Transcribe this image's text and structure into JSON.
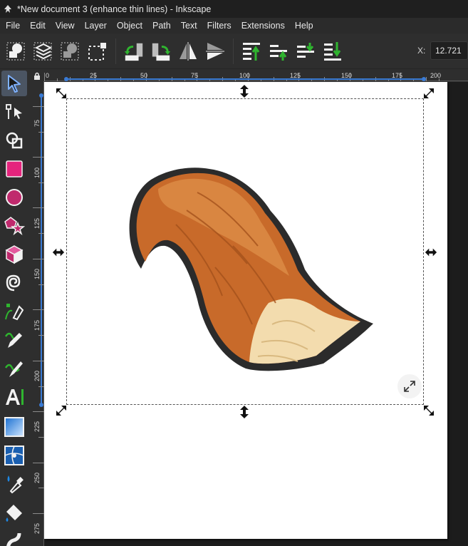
{
  "window": {
    "title": "*New document 3 (enhance thin lines) - Inkscape"
  },
  "menu": {
    "items": [
      {
        "label": "File"
      },
      {
        "label": "Edit"
      },
      {
        "label": "View"
      },
      {
        "label": "Layer"
      },
      {
        "label": "Object"
      },
      {
        "label": "Path"
      },
      {
        "label": "Text"
      },
      {
        "label": "Filters"
      },
      {
        "label": "Extensions"
      },
      {
        "label": "Help"
      }
    ]
  },
  "toolbar": {
    "x_label": "X:",
    "x_value": "12.721"
  },
  "ruler": {
    "top_labels": [
      "0",
      "25",
      "50",
      "75",
      "100",
      "125",
      "150",
      "175",
      "200"
    ],
    "left_labels": [
      "75",
      "100",
      "125",
      "150",
      "175",
      "200",
      "225",
      "250",
      "275"
    ]
  },
  "colors": {
    "accent_selection": "#3a7bd5",
    "rect_tool": "#e5247d",
    "fox_tail_orange": "#c86a2a",
    "fox_tail_cream": "#f3dcae",
    "outline": "#2b2b2b"
  }
}
